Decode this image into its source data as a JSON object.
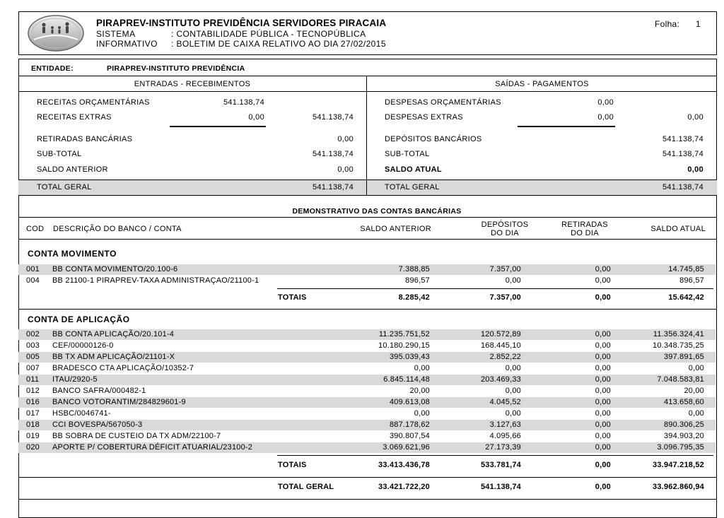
{
  "header": {
    "title": "PIRAPREV-INSTITUTO PREVIDÊNCIA SERVIDORES PIRACAIA",
    "sistema_label": "SISTEMA",
    "sistema_value": ": CONTABILIDADE PÚBLICA - TECNOPÚBLICA",
    "informativo_label": "INFORMATIVO",
    "informativo_value": ": BOLETIM DE CAIXA RELATIVO AO DIA 27/02/2015",
    "folha_label": "Folha:",
    "folha_value": "1"
  },
  "entidade": {
    "label": "ENTIDADE:",
    "value": "PIRAPREV-INSTITUTO PREVIDÊNCIA"
  },
  "entradas": {
    "heading": "ENTRADAS - RECEBIMENTOS",
    "receitas_orc_label": "RECEITAS ORÇAMENTÁRIAS",
    "receitas_orc_value": "541.138,74",
    "receitas_extras_label": "RECEITAS EXTRAS",
    "receitas_extras_value": "0,00",
    "receitas_total": "541.138,74",
    "retiradas_label": "RETIRADAS BANCÁRIAS",
    "retiradas_value": "0,00",
    "subtotal_label": "SUB-TOTAL",
    "subtotal_value": "541.138,74",
    "saldo_anterior_label": "SALDO ANTERIOR",
    "saldo_anterior_value": "0,00",
    "total_geral_label": "TOTAL GERAL",
    "total_geral_value": "541.138,74"
  },
  "saidas": {
    "heading": "SAÍDAS - PAGAMENTOS",
    "despesas_orc_label": "DESPESAS ORÇAMENTÁRIAS",
    "despesas_orc_value": "0,00",
    "despesas_extras_label": "DESPESAS EXTRAS",
    "despesas_extras_value": "0,00",
    "despesas_total": "0,00",
    "depositos_label": "DEPÓSITOS BANCÁRIOS",
    "depositos_value": "541.138,74",
    "subtotal_label": "SUB-TOTAL",
    "subtotal_value": "541.138,74",
    "saldo_atual_label": "SALDO ATUAL",
    "saldo_atual_value": "0,00",
    "total_geral_label": "TOTAL GERAL",
    "total_geral_value": "541.138,74"
  },
  "demonstrativo": {
    "title": "DEMONSTRATIVO DAS CONTAS BANCÁRIAS",
    "columns": {
      "cod": "COD",
      "descricao": "DESCRIÇÃO DO BANCO / CONTA",
      "saldo_anterior": "SALDO ANTERIOR",
      "depositos_1": "DEPÓSITOS",
      "depositos_2": "DO DIA",
      "retiradas_1": "RETIRADAS",
      "retiradas_2": "DO DIA",
      "saldo_atual": "SALDO ATUAL"
    },
    "movimento": {
      "heading": "CONTA MOVIMENTO",
      "rows": [
        {
          "cod": "001",
          "desc": "BB CONTA MOVIMENTO/20.100-6",
          "ant": "7.388,85",
          "dep": "7.357,00",
          "ret": "0,00",
          "atual": "14.745,85"
        },
        {
          "cod": "004",
          "desc": "BB 21100-1 PIRAPREV-TAXA ADMINISTRAÇAO/21100-1",
          "ant": "896,57",
          "dep": "0,00",
          "ret": "0,00",
          "atual": "896,57"
        }
      ],
      "totais": {
        "label": "TOTAIS",
        "ant": "8.285,42",
        "dep": "7.357,00",
        "ret": "0,00",
        "atual": "15.642,42"
      }
    },
    "aplicacao": {
      "heading": "CONTA DE APLICAÇÃO",
      "rows": [
        {
          "cod": "002",
          "desc": "BB CONTA APLICAÇÃO/20.101-4",
          "ant": "11.235.751,52",
          "dep": "120.572,89",
          "ret": "0,00",
          "atual": "11.356.324,41"
        },
        {
          "cod": "003",
          "desc": "CEF/00000126-0",
          "ant": "10.180.290,15",
          "dep": "168.445,10",
          "ret": "0,00",
          "atual": "10.348.735,25"
        },
        {
          "cod": "005",
          "desc": "BB TX ADM APLICAÇÃO/21101-X",
          "ant": "395.039,43",
          "dep": "2.852,22",
          "ret": "0,00",
          "atual": "397.891,65"
        },
        {
          "cod": "007",
          "desc": "BRADESCO CTA APLICAÇÃO/10352-7",
          "ant": "0,00",
          "dep": "0,00",
          "ret": "0,00",
          "atual": "0,00"
        },
        {
          "cod": "011",
          "desc": "ITAU/2920-5",
          "ant": "6.845.114,48",
          "dep": "203.469,33",
          "ret": "0,00",
          "atual": "7.048.583,81"
        },
        {
          "cod": "012",
          "desc": "BANCO SAFRA/000482-1",
          "ant": "20,00",
          "dep": "0,00",
          "ret": "0,00",
          "atual": "20,00"
        },
        {
          "cod": "016",
          "desc": "BANCO VOTORANTIM/284829601-9",
          "ant": "409.613,08",
          "dep": "4.045,52",
          "ret": "0,00",
          "atual": "413.658,60"
        },
        {
          "cod": "017",
          "desc": "HSBC/0046741-",
          "ant": "0,00",
          "dep": "0,00",
          "ret": "0,00",
          "atual": "0,00"
        },
        {
          "cod": "018",
          "desc": "CCI BOVESPA/567050-3",
          "ant": "887.178,62",
          "dep": "3.127,63",
          "ret": "0,00",
          "atual": "890.306,25"
        },
        {
          "cod": "019",
          "desc": "BB SOBRA DE CUSTEIO DA TX ADM/22100-7",
          "ant": "390.807,54",
          "dep": "4.095,66",
          "ret": "0,00",
          "atual": "394.903,20"
        },
        {
          "cod": "020",
          "desc": "APORTE P/ COBERTURA DÉFICIT ATUARIAL/23100-2",
          "ant": "3.069.621,96",
          "dep": "27.173,39",
          "ret": "0,00",
          "atual": "3.096.795,35"
        }
      ],
      "totais": {
        "label": "TOTAIS",
        "ant": "33.413.436,78",
        "dep": "533.781,74",
        "ret": "0,00",
        "atual": "33.947.218,52"
      }
    },
    "total_geral": {
      "label": "TOTAL GERAL",
      "ant": "33.421.722,20",
      "dep": "541.138,74",
      "ret": "0,00",
      "atual": "33.962.860,94"
    }
  }
}
